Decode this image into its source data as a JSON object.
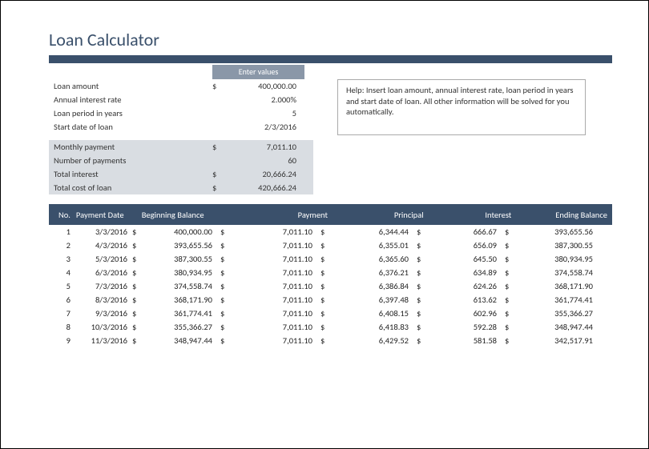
{
  "title": "Loan Calculator",
  "enter_values_label": "Enter values",
  "inputs": {
    "loan_amount_label": "Loan amount",
    "loan_amount_value": "400,000.00",
    "annual_rate_label": "Annual interest rate",
    "annual_rate_value": "2.000%",
    "loan_period_label": "Loan period in years",
    "loan_period_value": "5",
    "start_date_label": "Start date of loan",
    "start_date_value": "2/3/2016"
  },
  "computed": {
    "monthly_payment_label": "Monthly payment",
    "monthly_payment_value": "7,011.10",
    "num_payments_label": "Number of payments",
    "num_payments_value": "60",
    "total_interest_label": "Total interest",
    "total_interest_value": "20,666.24",
    "total_cost_label": "Total cost of loan",
    "total_cost_value": "420,666.24"
  },
  "help_text": "Help: Insert loan amount, annual interest rate, loan period in years and start date of loan. All other information will be solved for you automatically.",
  "currency_symbol": "$",
  "schedule": {
    "headers": {
      "no": "No.",
      "date": "Payment Date",
      "beg": "Beginning Balance",
      "pay": "Payment",
      "prin": "Principal",
      "int": "Interest",
      "end": "Ending Balance"
    },
    "rows": [
      {
        "no": "1",
        "date": "3/3/2016",
        "beg": "400,000.00",
        "pay": "7,011.10",
        "prin": "6,344.44",
        "int": "666.67",
        "end": "393,655.56"
      },
      {
        "no": "2",
        "date": "4/3/2016",
        "beg": "393,655.56",
        "pay": "7,011.10",
        "prin": "6,355.01",
        "int": "656.09",
        "end": "387,300.55"
      },
      {
        "no": "3",
        "date": "5/3/2016",
        "beg": "387,300.55",
        "pay": "7,011.10",
        "prin": "6,365.60",
        "int": "645.50",
        "end": "380,934.95"
      },
      {
        "no": "4",
        "date": "6/3/2016",
        "beg": "380,934.95",
        "pay": "7,011.10",
        "prin": "6,376.21",
        "int": "634.89",
        "end": "374,558.74"
      },
      {
        "no": "5",
        "date": "7/3/2016",
        "beg": "374,558.74",
        "pay": "7,011.10",
        "prin": "6,386.84",
        "int": "624.26",
        "end": "368,171.90"
      },
      {
        "no": "6",
        "date": "8/3/2016",
        "beg": "368,171.90",
        "pay": "7,011.10",
        "prin": "6,397.48",
        "int": "613.62",
        "end": "361,774.41"
      },
      {
        "no": "7",
        "date": "9/3/2016",
        "beg": "361,774.41",
        "pay": "7,011.10",
        "prin": "6,408.15",
        "int": "602.96",
        "end": "355,366.27"
      },
      {
        "no": "8",
        "date": "10/3/2016",
        "beg": "355,366.27",
        "pay": "7,011.10",
        "prin": "6,418.83",
        "int": "592.28",
        "end": "348,947.44"
      },
      {
        "no": "9",
        "date": "11/3/2016",
        "beg": "348,947.44",
        "pay": "7,011.10",
        "prin": "6,429.52",
        "int": "581.58",
        "end": "342,517.91"
      }
    ]
  }
}
